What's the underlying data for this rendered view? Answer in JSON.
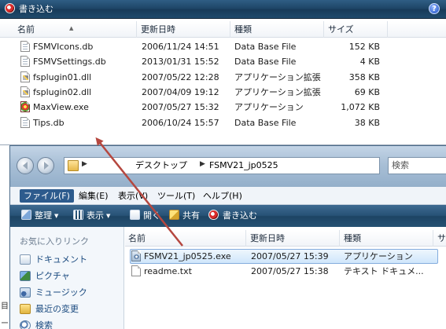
{
  "top_window": {
    "cmdbar": {
      "burn_label": "書き込む",
      "help_label": "?"
    },
    "columns": [
      "名前",
      "更新日時",
      "種類",
      "サイズ"
    ],
    "files": [
      {
        "icon": "db-file-icon",
        "name": "FSMVIcons.db",
        "date": "2006/11/24 14:51",
        "type": "Data Base File",
        "size": "152 KB"
      },
      {
        "icon": "db-file-icon",
        "name": "FSMVSettings.db",
        "date": "2013/01/31 15:52",
        "type": "Data Base File",
        "size": "4 KB"
      },
      {
        "icon": "dll-file-icon",
        "name": "fsplugin01.dll",
        "date": "2007/05/22 12:28",
        "type": "アプリケーション拡張",
        "size": "358 KB"
      },
      {
        "icon": "dll-file-icon",
        "name": "fsplugin02.dll",
        "date": "2007/04/09 19:12",
        "type": "アプリケーション拡張",
        "size": "69 KB"
      },
      {
        "icon": "maxview-exe-icon",
        "name": "MaxView.exe",
        "date": "2007/05/27 15:32",
        "type": "アプリケーション",
        "size": "1,072 KB"
      },
      {
        "icon": "db-file-icon",
        "name": "Tips.db",
        "date": "2006/10/24 15:57",
        "type": "Data Base File",
        "size": "38 KB"
      }
    ]
  },
  "front_window": {
    "address": {
      "segments": [
        "デスクトップ",
        "FSMV21_jp0525"
      ]
    },
    "search": {
      "placeholder": "検索"
    },
    "menu": [
      "ファイル(F)",
      "編集(E)",
      "表示(V)",
      "ツール(T)",
      "ヘルプ(H)"
    ],
    "toolbar": {
      "organize": "整理",
      "views": "表示",
      "open": "開く",
      "share": "共有",
      "burn": "書き込む"
    },
    "favorites": {
      "title": "お気に入りリンク",
      "items": [
        "ドキュメント",
        "ピクチャ",
        "ミュージック",
        "最近の変更",
        "検索"
      ]
    },
    "columns": [
      "名前",
      "更新日時",
      "種類",
      "サ"
    ],
    "files": [
      {
        "icon": "installer-exe-icon",
        "name": "FSMV21_jp0525.exe",
        "date": "2007/05/27 15:39",
        "type": "アプリケーション",
        "selected": true
      },
      {
        "icon": "text-file-icon",
        "name": "readme.txt",
        "date": "2007/05/27 15:38",
        "type": "テキスト ドキュメ..."
      }
    ]
  },
  "left_strip": [
    "目",
    "ー"
  ],
  "colors": {
    "cmdbar": "#1f4a6d",
    "selection": "#cfe6fb",
    "arrow": "#b5473f",
    "link": "#1a4a7f"
  }
}
